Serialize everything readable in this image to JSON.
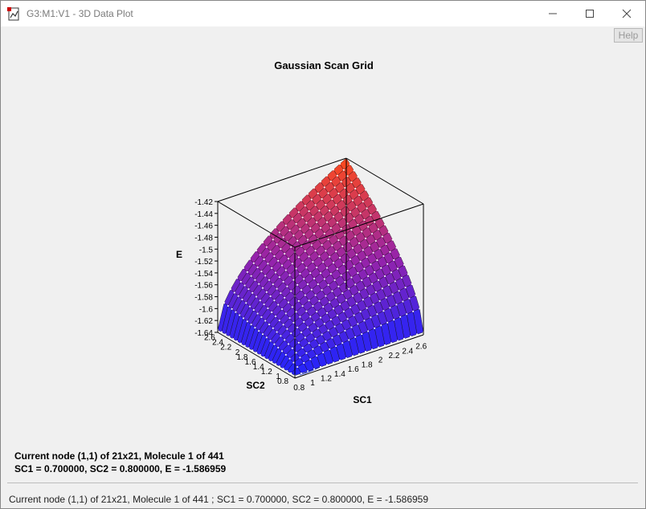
{
  "window": {
    "title": "G3:M1:V1 - 3D Data Plot",
    "help_label": "Help",
    "icons": {
      "app": "document-chart-icon",
      "minimize": "minimize-icon",
      "maximize": "maximize-icon",
      "close": "close-icon"
    }
  },
  "plot": {
    "title": "Gaussian Scan Grid",
    "info_line1": "Current node (1,1) of 21x21, Molecule 1 of 441",
    "info_line2": "SC1 = 0.700000, SC2 = 0.800000, E = -1.586959",
    "colors": {
      "low": "#1f24ff",
      "mid": "#9020b0",
      "high": "#ff4a1a"
    }
  },
  "chart_data": {
    "type": "surface",
    "title": "Gaussian Scan Grid",
    "xlabel": "SC1",
    "ylabel": "SC2",
    "zlabel": "E",
    "x_tick_labels": [
      "0.8",
      "1",
      "1.2",
      "1.4",
      "1.6",
      "1.8",
      "2",
      "2.2",
      "2.4",
      "2.6"
    ],
    "y_tick_labels": [
      "0.8",
      "1",
      "1.2",
      "1.4",
      "1.6",
      "1.8",
      "2",
      "2.2",
      "2.4",
      "2.6"
    ],
    "z_tick_labels": [
      "-1.42",
      "-1.44",
      "-1.46",
      "-1.48",
      "-1.5",
      "-1.52",
      "-1.54",
      "-1.56",
      "-1.58",
      "-1.6",
      "-1.62",
      "-1.64"
    ],
    "grid": "21x21",
    "xlim": [
      0.7,
      2.7
    ],
    "ylim": [
      0.8,
      2.8
    ],
    "zlim": [
      -1.64,
      -1.42
    ],
    "current_node": {
      "i": 1,
      "j": 1,
      "SC1": 0.7,
      "SC2": 0.8,
      "E": -1.586959
    }
  },
  "status": {
    "text": "Current node (1,1) of 21x21, Molecule 1 of 441 ; SC1 = 0.700000, SC2 = 0.800000, E = -1.586959"
  }
}
